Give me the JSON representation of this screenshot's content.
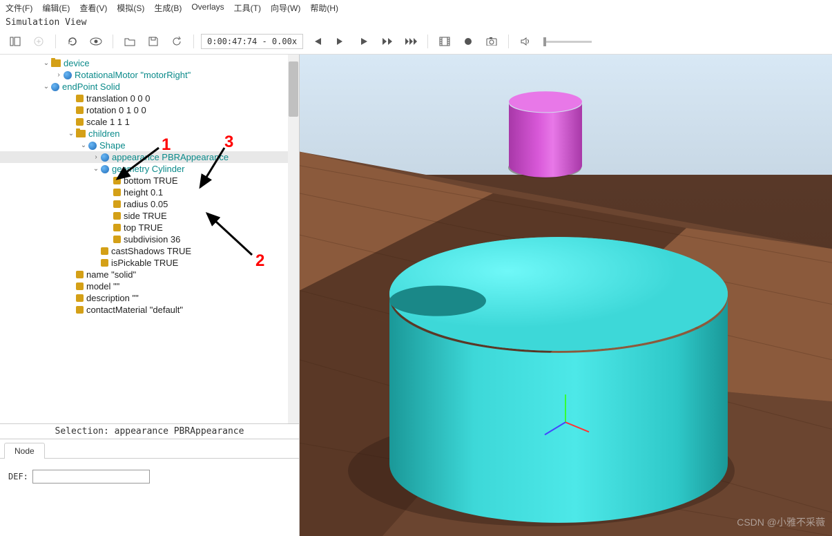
{
  "menu": [
    "文件(F)",
    "编辑(E)",
    "查看(V)",
    "模拟(S)",
    "生成(B)",
    "Overlays",
    "工具(T)",
    "向导(W)",
    "帮助(H)"
  ],
  "simLabel": "Simulation View",
  "toolbar": {
    "time": "0:00:47:74 - 0.00x",
    "icons": [
      "layout",
      "add",
      "reload",
      "eye",
      "open",
      "save",
      "refresh2",
      "skip-back",
      "step-back",
      "play",
      "fast-forward",
      "skip-forward",
      "film",
      "record",
      "camera",
      "volume"
    ]
  },
  "tree": [
    {
      "ind": 1,
      "exp": "v",
      "ico": "folder",
      "label": "device",
      "cls": ""
    },
    {
      "ind": 2,
      "exp": ">",
      "ico": "sphere",
      "label": "RotationalMotor \"motorRight\"",
      "cls": ""
    },
    {
      "ind": 1,
      "exp": "v",
      "ico": "sphere",
      "label": "endPoint Solid",
      "cls": ""
    },
    {
      "ind": 3,
      "exp": " ",
      "ico": "field",
      "label": "translation 0 0 0",
      "cls": "black"
    },
    {
      "ind": 3,
      "exp": " ",
      "ico": "field",
      "label": "rotation 0 1 0 0",
      "cls": "black"
    },
    {
      "ind": 3,
      "exp": " ",
      "ico": "field",
      "label": "scale 1 1 1",
      "cls": "black"
    },
    {
      "ind": 3,
      "exp": "v",
      "ico": "folder",
      "label": "children",
      "cls": ""
    },
    {
      "ind": 4,
      "exp": "v",
      "ico": "sphere",
      "label": "Shape",
      "cls": ""
    },
    {
      "ind": 5,
      "exp": ">",
      "ico": "sphere",
      "label": "appearance PBRAppearance",
      "cls": "",
      "sel": true
    },
    {
      "ind": 5,
      "exp": "v",
      "ico": "sphere",
      "label": "geometry Cylinder",
      "cls": ""
    },
    {
      "ind": 6,
      "exp": " ",
      "ico": "field",
      "label": "bottom TRUE",
      "cls": "black"
    },
    {
      "ind": 6,
      "exp": " ",
      "ico": "field",
      "label": "height 0.1",
      "cls": "black"
    },
    {
      "ind": 6,
      "exp": " ",
      "ico": "field",
      "label": "radius 0.05",
      "cls": "black"
    },
    {
      "ind": 6,
      "exp": " ",
      "ico": "field",
      "label": "side TRUE",
      "cls": "black"
    },
    {
      "ind": 6,
      "exp": " ",
      "ico": "field",
      "label": "top TRUE",
      "cls": "black"
    },
    {
      "ind": 6,
      "exp": " ",
      "ico": "field",
      "label": "subdivision 36",
      "cls": "black"
    },
    {
      "ind": 5,
      "exp": " ",
      "ico": "field",
      "label": "castShadows TRUE",
      "cls": "black"
    },
    {
      "ind": 5,
      "exp": " ",
      "ico": "field",
      "label": "isPickable TRUE",
      "cls": "black"
    },
    {
      "ind": 3,
      "exp": " ",
      "ico": "field",
      "label": "name \"solid\"",
      "cls": "black"
    },
    {
      "ind": 3,
      "exp": " ",
      "ico": "field",
      "label": "model \"\"",
      "cls": "black"
    },
    {
      "ind": 3,
      "exp": " ",
      "ico": "field",
      "label": "description \"\"",
      "cls": "black"
    },
    {
      "ind": 3,
      "exp": " ",
      "ico": "field",
      "label": "contactMaterial \"default\"",
      "cls": "black"
    }
  ],
  "selection": "Selection: appearance PBRAppearance",
  "nodeTab": "Node",
  "defLabel": "DEF:",
  "defValue": "",
  "annotations": {
    "a1": "1",
    "a2": "2",
    "a3": "3"
  },
  "watermark": "CSDN @小雅不采薇"
}
